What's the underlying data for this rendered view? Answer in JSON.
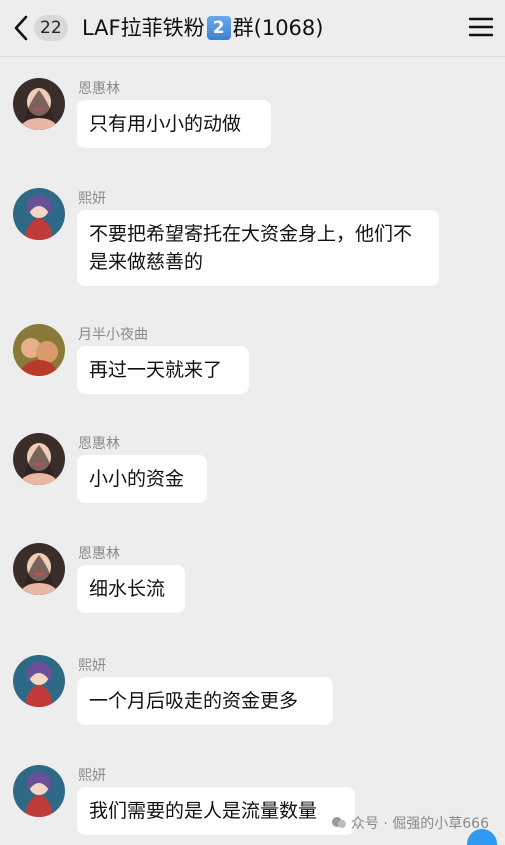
{
  "header": {
    "unread_count": "22",
    "title_prefix": "LAF拉菲铁粉",
    "title_number": "2",
    "title_suffix": "群(1068)"
  },
  "messages": [
    {
      "sender": "恩惠林",
      "text": "只有用小小的动做",
      "avatar": "woman-avatar"
    },
    {
      "sender": "熙妍",
      "text": "不要把希望寄托在大资金身上，他们不是来做慈善的",
      "avatar": "anime-girl-avatar"
    },
    {
      "sender": "月半小夜曲",
      "text": "再过一天就来了",
      "avatar": "photo-avatar"
    },
    {
      "sender": "恩惠林",
      "text": "小小的资金",
      "avatar": "woman-avatar"
    },
    {
      "sender": "恩惠林",
      "text": "细水长流",
      "avatar": "woman-avatar"
    },
    {
      "sender": "熙妍",
      "text": "一个月后吸走的资金更多",
      "avatar": "anime-girl-avatar"
    },
    {
      "sender": "熙妍",
      "text": "我们需要的是人是流量数量",
      "avatar": "anime-girl-avatar"
    }
  ],
  "watermark": "众号 · 倔强的小草666",
  "colors": {
    "background": "#ededed",
    "bubble": "#ffffff",
    "sender_text": "#8a8a8a"
  }
}
